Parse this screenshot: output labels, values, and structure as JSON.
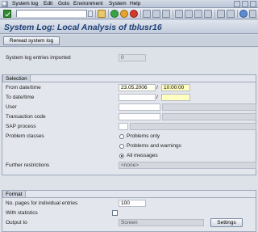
{
  "menubar": {
    "items": [
      "System log",
      "Edit",
      "Goto",
      "Environment",
      "System",
      "Help"
    ]
  },
  "title": "System Log: Local Analysis of tblusr16",
  "apptoolbar": {
    "reread_label": "Reread system log"
  },
  "imported": {
    "label": "System log entries imported",
    "value": "0"
  },
  "selection": {
    "title": "Selection",
    "from_label": "From date/time",
    "from_date": "23.05.2006",
    "from_sep": "/",
    "from_time": "10:00:00",
    "to_label": "To date/time",
    "to_date": "",
    "to_sep": "/",
    "to_time": "",
    "user_label": "User",
    "user_value": "",
    "tcode_label": "Transaction code",
    "tcode_value": "",
    "sap_process_label": "SAP process",
    "sap_process_value": "",
    "problem_classes_label": "Problem classes",
    "radio_problems_only": "Problems only",
    "radio_problems_warnings": "Problems and warnings",
    "radio_all_messages": "All messages",
    "further_label": "Further restrictions",
    "further_value": "<none>"
  },
  "format": {
    "title": "Format",
    "pages_label": "No. pages for individual entries",
    "pages_value": "100",
    "stats_label": "With statistics",
    "output_label": "Output to",
    "output_value": "Screen",
    "settings_label": "Settings"
  }
}
